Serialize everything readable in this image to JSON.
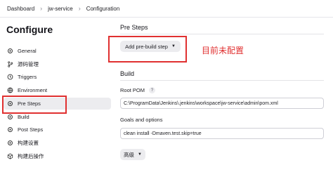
{
  "breadcrumb": {
    "items": [
      "Dashboard",
      "jw-service",
      "Configuration"
    ],
    "separator": "›"
  },
  "page_title": "Configure",
  "sidebar": {
    "items": [
      {
        "label": "General",
        "icon": "gear-icon"
      },
      {
        "label": "源码管理",
        "icon": "branch-icon"
      },
      {
        "label": "Triggers",
        "icon": "clock-icon"
      },
      {
        "label": "Environment",
        "icon": "globe-icon"
      },
      {
        "label": "Pre Steps",
        "icon": "gear-icon",
        "active": true
      },
      {
        "label": "Build",
        "icon": "gear-icon"
      },
      {
        "label": "Post Steps",
        "icon": "gear-icon"
      },
      {
        "label": "构建设置",
        "icon": "gear-icon"
      },
      {
        "label": "构建后操作",
        "icon": "cube-icon"
      }
    ]
  },
  "pre_steps": {
    "title": "Pre Steps",
    "add_button": "Add pre-build step",
    "annotation": "目前未配置"
  },
  "build": {
    "title": "Build",
    "root_pom_label": "Root POM",
    "root_pom_value": "C:\\ProgramData\\Jenkins\\.jenkins\\workspace\\jw-service\\admin\\pom.xml",
    "goals_label": "Goals and options",
    "goals_value": "clean install -Dmaven.test.skip=true",
    "advanced_button": "高级",
    "help_glyph": "?"
  },
  "colors": {
    "highlight": "#e03030",
    "active_bg": "#ececef"
  }
}
